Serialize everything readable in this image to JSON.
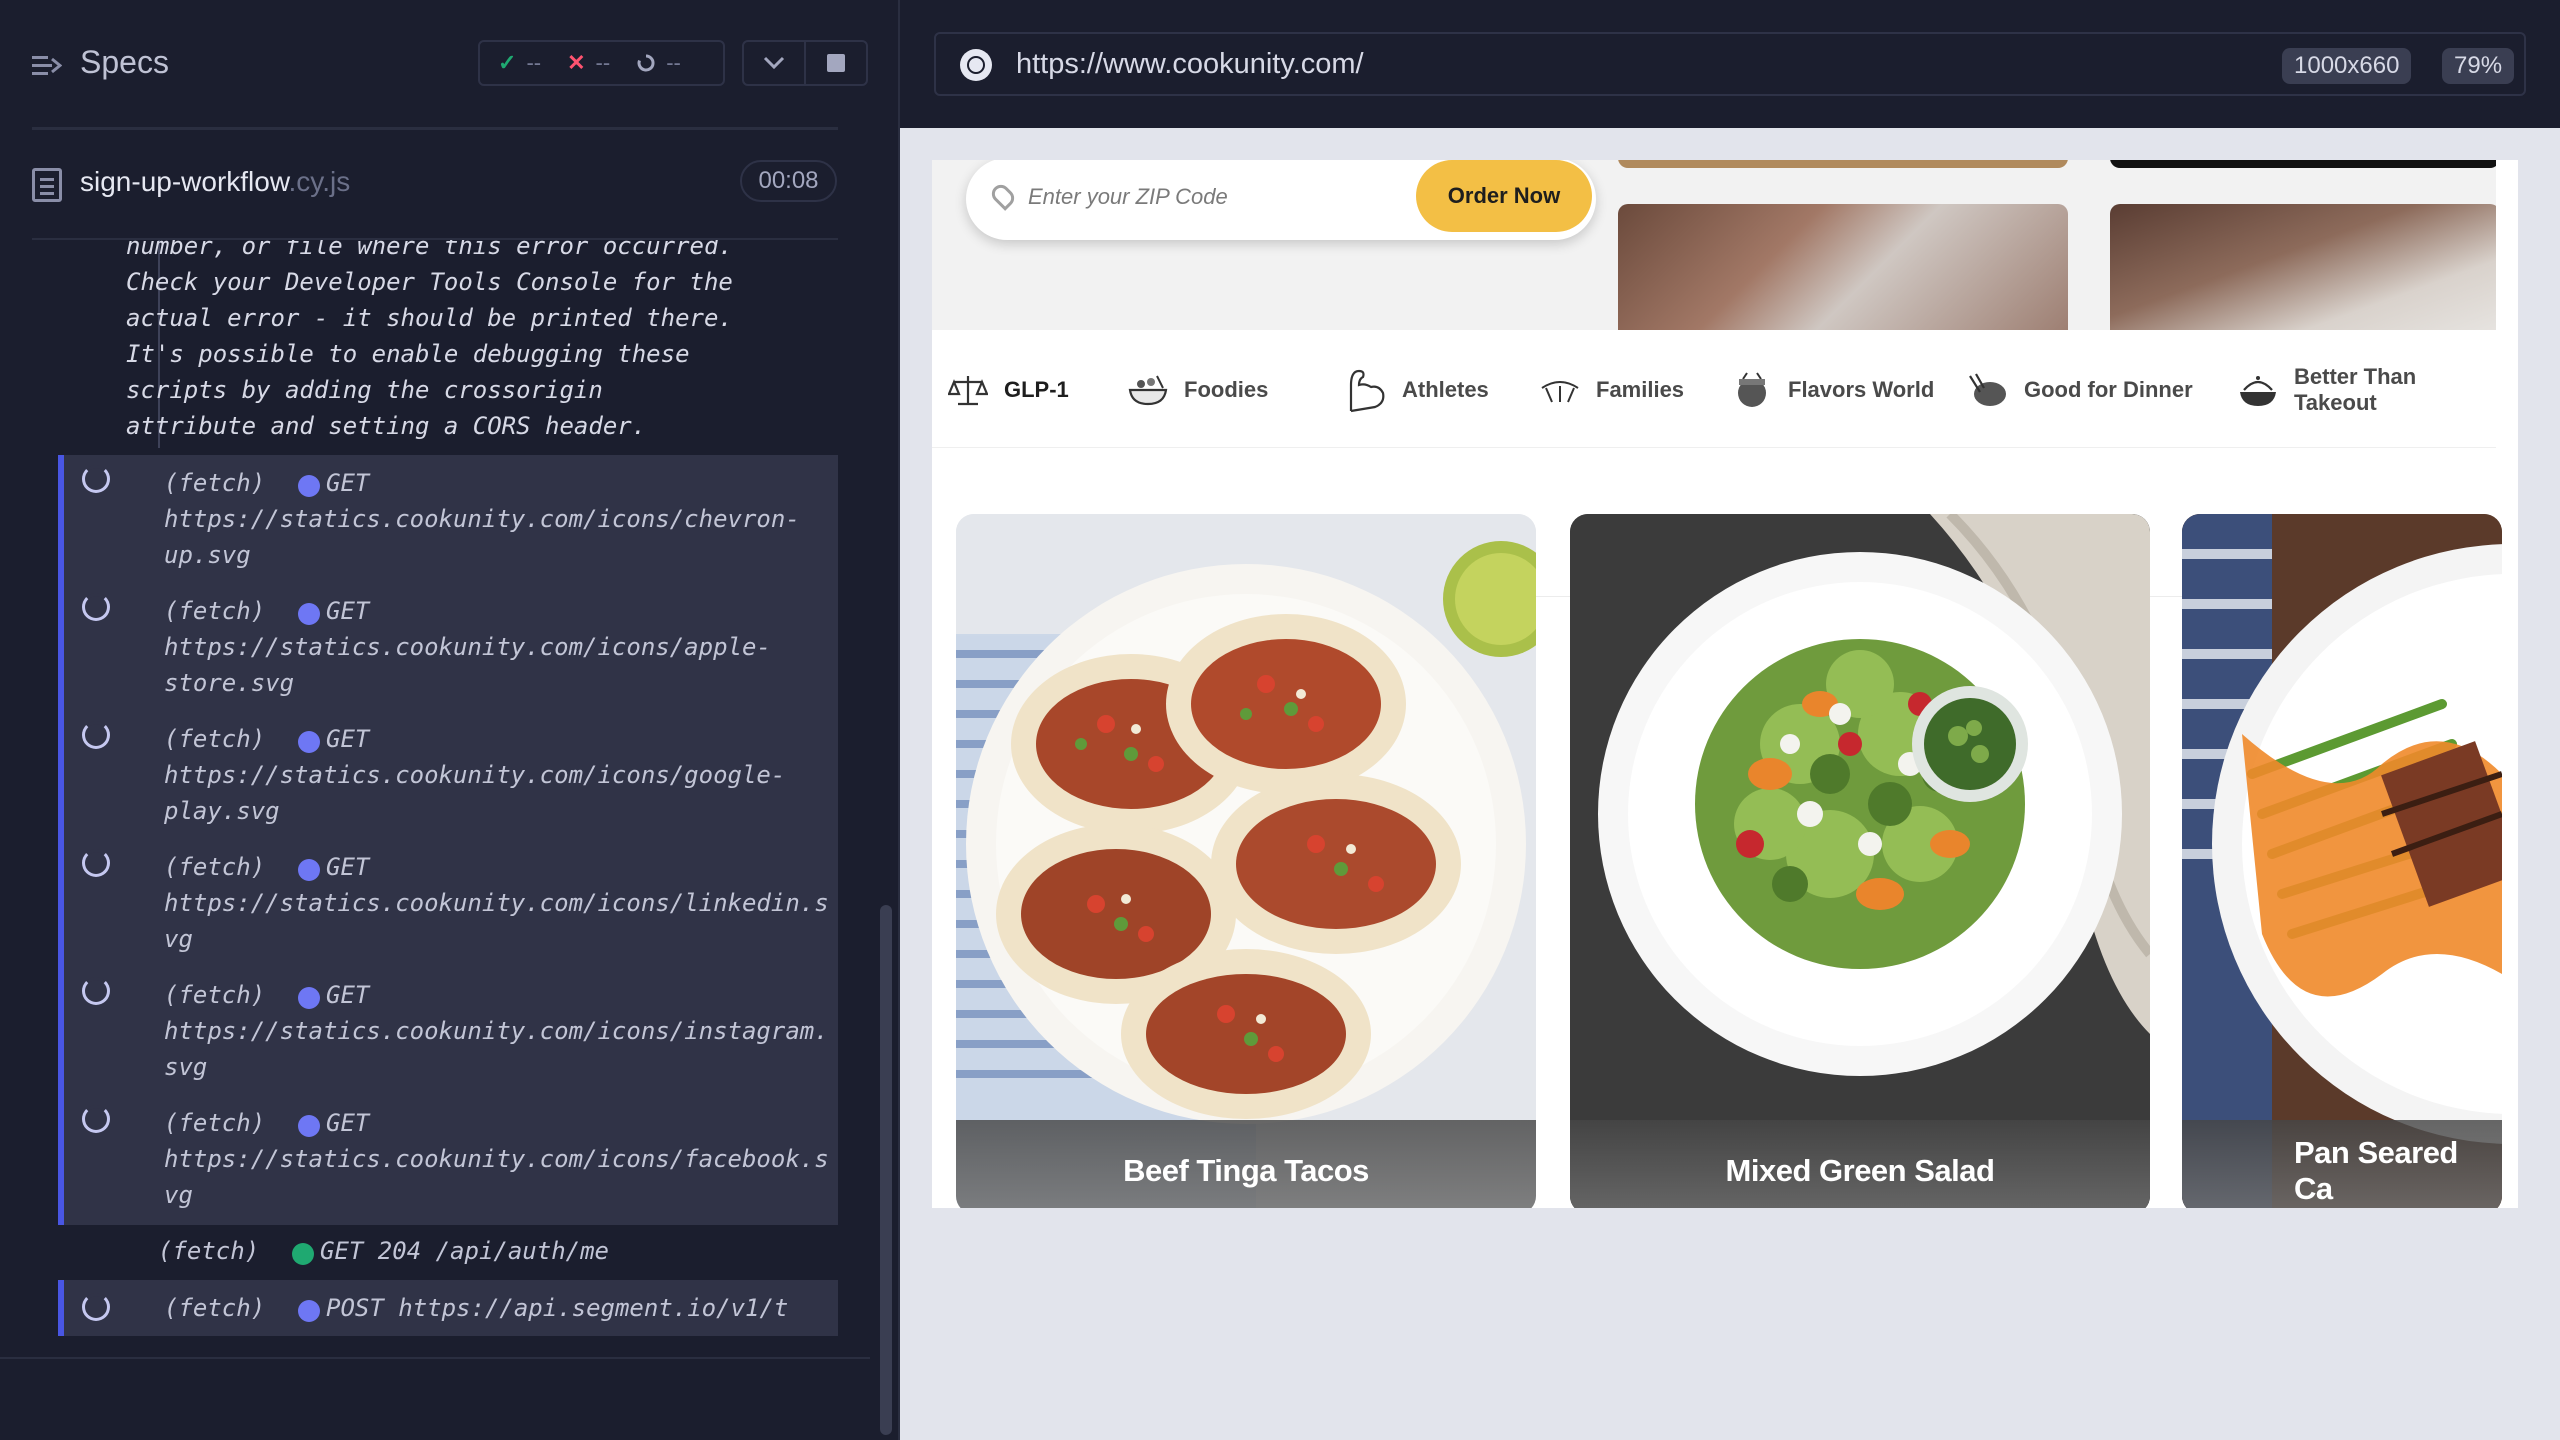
{
  "runner": {
    "specs_title": "Specs",
    "stats": {
      "passed": "--",
      "failed": "--",
      "pending": "--"
    },
    "spec": {
      "name": "sign-up-workflow",
      "ext": ".cy.js",
      "time": "00:08"
    },
    "error_lines": [
      "number, or file where this error occurred.",
      "Check your Developer Tools Console for the",
      "actual error - it should be printed there.",
      "It's possible to enable debugging these",
      "scripts by adding the crossorigin",
      "attribute and setting a CORS header."
    ],
    "commands": [
      {
        "name": "(fetch)",
        "method": "GET",
        "url1": "https://statics.cookunity.com/icons/chevron-",
        "url2": "up.svg"
      },
      {
        "name": "(fetch)",
        "method": "GET",
        "url1": "https://statics.cookunity.com/icons/apple-",
        "url2": "store.svg"
      },
      {
        "name": "(fetch)",
        "method": "GET",
        "url1": "https://statics.cookunity.com/icons/google-",
        "url2": "play.svg"
      },
      {
        "name": "(fetch)",
        "method": "GET",
        "url1": "https://statics.cookunity.com/icons/linkedin.s",
        "url2": "vg"
      },
      {
        "name": "(fetch)",
        "method": "GET",
        "url1": "https://statics.cookunity.com/icons/instagram.",
        "url2": "svg"
      },
      {
        "name": "(fetch)",
        "method": "GET",
        "url1": "https://statics.cookunity.com/icons/facebook.s",
        "url2": "vg"
      }
    ],
    "ok_command": {
      "name": "(fetch)",
      "text": "GET 204 /api/auth/me"
    },
    "post_command": {
      "name": "(fetch)",
      "text": "POST https://api.segment.io/v1/t"
    }
  },
  "aut": {
    "url": "https://www.cookunity.com/",
    "viewport": "1000x660",
    "zoom": "79%"
  },
  "site": {
    "zip_placeholder": "Enter your ZIP Code",
    "order_button": "Order Now",
    "tabs": [
      {
        "label": "GLP-1",
        "icon": "scale-icon"
      },
      {
        "label": "Foodies",
        "icon": "bowl-icon"
      },
      {
        "label": "Athletes",
        "icon": "flexed-arm-icon"
      },
      {
        "label": "Families",
        "icon": "family-icon"
      },
      {
        "label": "Flavors World",
        "icon": "globe-food-icon"
      },
      {
        "label": "Good for Dinner",
        "icon": "dinner-icon"
      },
      {
        "label": "Better Than Takeout",
        "icon": "takeout-icon"
      }
    ],
    "cards": [
      {
        "title": "Beef Tinga Tacos"
      },
      {
        "title": "Mixed Green Salad"
      },
      {
        "title": "Pan Seared Ca"
      }
    ]
  },
  "colors": {
    "accent": "#4956e3",
    "pass": "#1fa971",
    "fail": "#ff5370",
    "order_button": "#f3bf45"
  }
}
